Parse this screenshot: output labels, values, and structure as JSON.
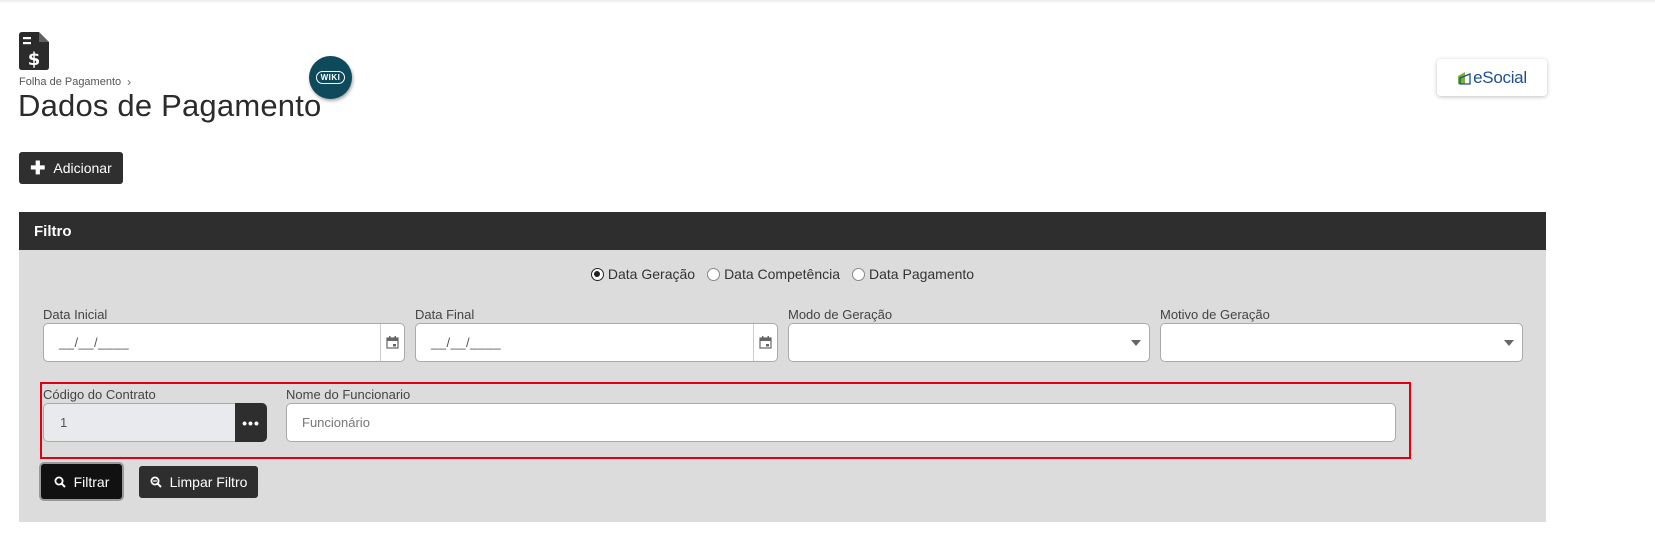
{
  "breadcrumb": {
    "parent": "Folha de Pagamento",
    "separator": "›"
  },
  "page": {
    "title": "Dados de Pagamento"
  },
  "wiki": {
    "label": "WIKI"
  },
  "esocial": {
    "label": "eSocial"
  },
  "toolbar": {
    "add_label": "Adicionar"
  },
  "filter": {
    "header": "Filtro",
    "radios": [
      {
        "label": "Data Geração",
        "checked": true
      },
      {
        "label": "Data Competência",
        "checked": false
      },
      {
        "label": "Data Pagamento",
        "checked": false
      }
    ],
    "data_inicial": {
      "label": "Data Inicial",
      "value": "__/__/____"
    },
    "data_final": {
      "label": "Data Final",
      "value": "__/__/____"
    },
    "modo_geracao": {
      "label": "Modo de Geração",
      "value": ""
    },
    "motivo_geracao": {
      "label": "Motivo de Geração",
      "value": ""
    },
    "codigo_contrato": {
      "label": "Código do Contrato",
      "value": "1",
      "lookup_label": "•••"
    },
    "nome_funcionario": {
      "label": "Nome do Funcionario",
      "placeholder": "Funcionário",
      "value": ""
    },
    "filtrar_label": "Filtrar",
    "limpar_label": "Limpar Filtro"
  },
  "colors": {
    "dark": "#2e2e2e",
    "panel": "#dcdcdc",
    "highlight": "#e0000f",
    "wiki": "#0f4a5c",
    "esocial": "#1d4f8c"
  },
  "icons": [
    "document-dollar-icon",
    "chevron-right-icon",
    "wiki-icon",
    "esocial-logo-icon",
    "plus-icon",
    "calendar-icon",
    "caret-down-icon",
    "ellipsis-icon",
    "search-icon"
  ]
}
